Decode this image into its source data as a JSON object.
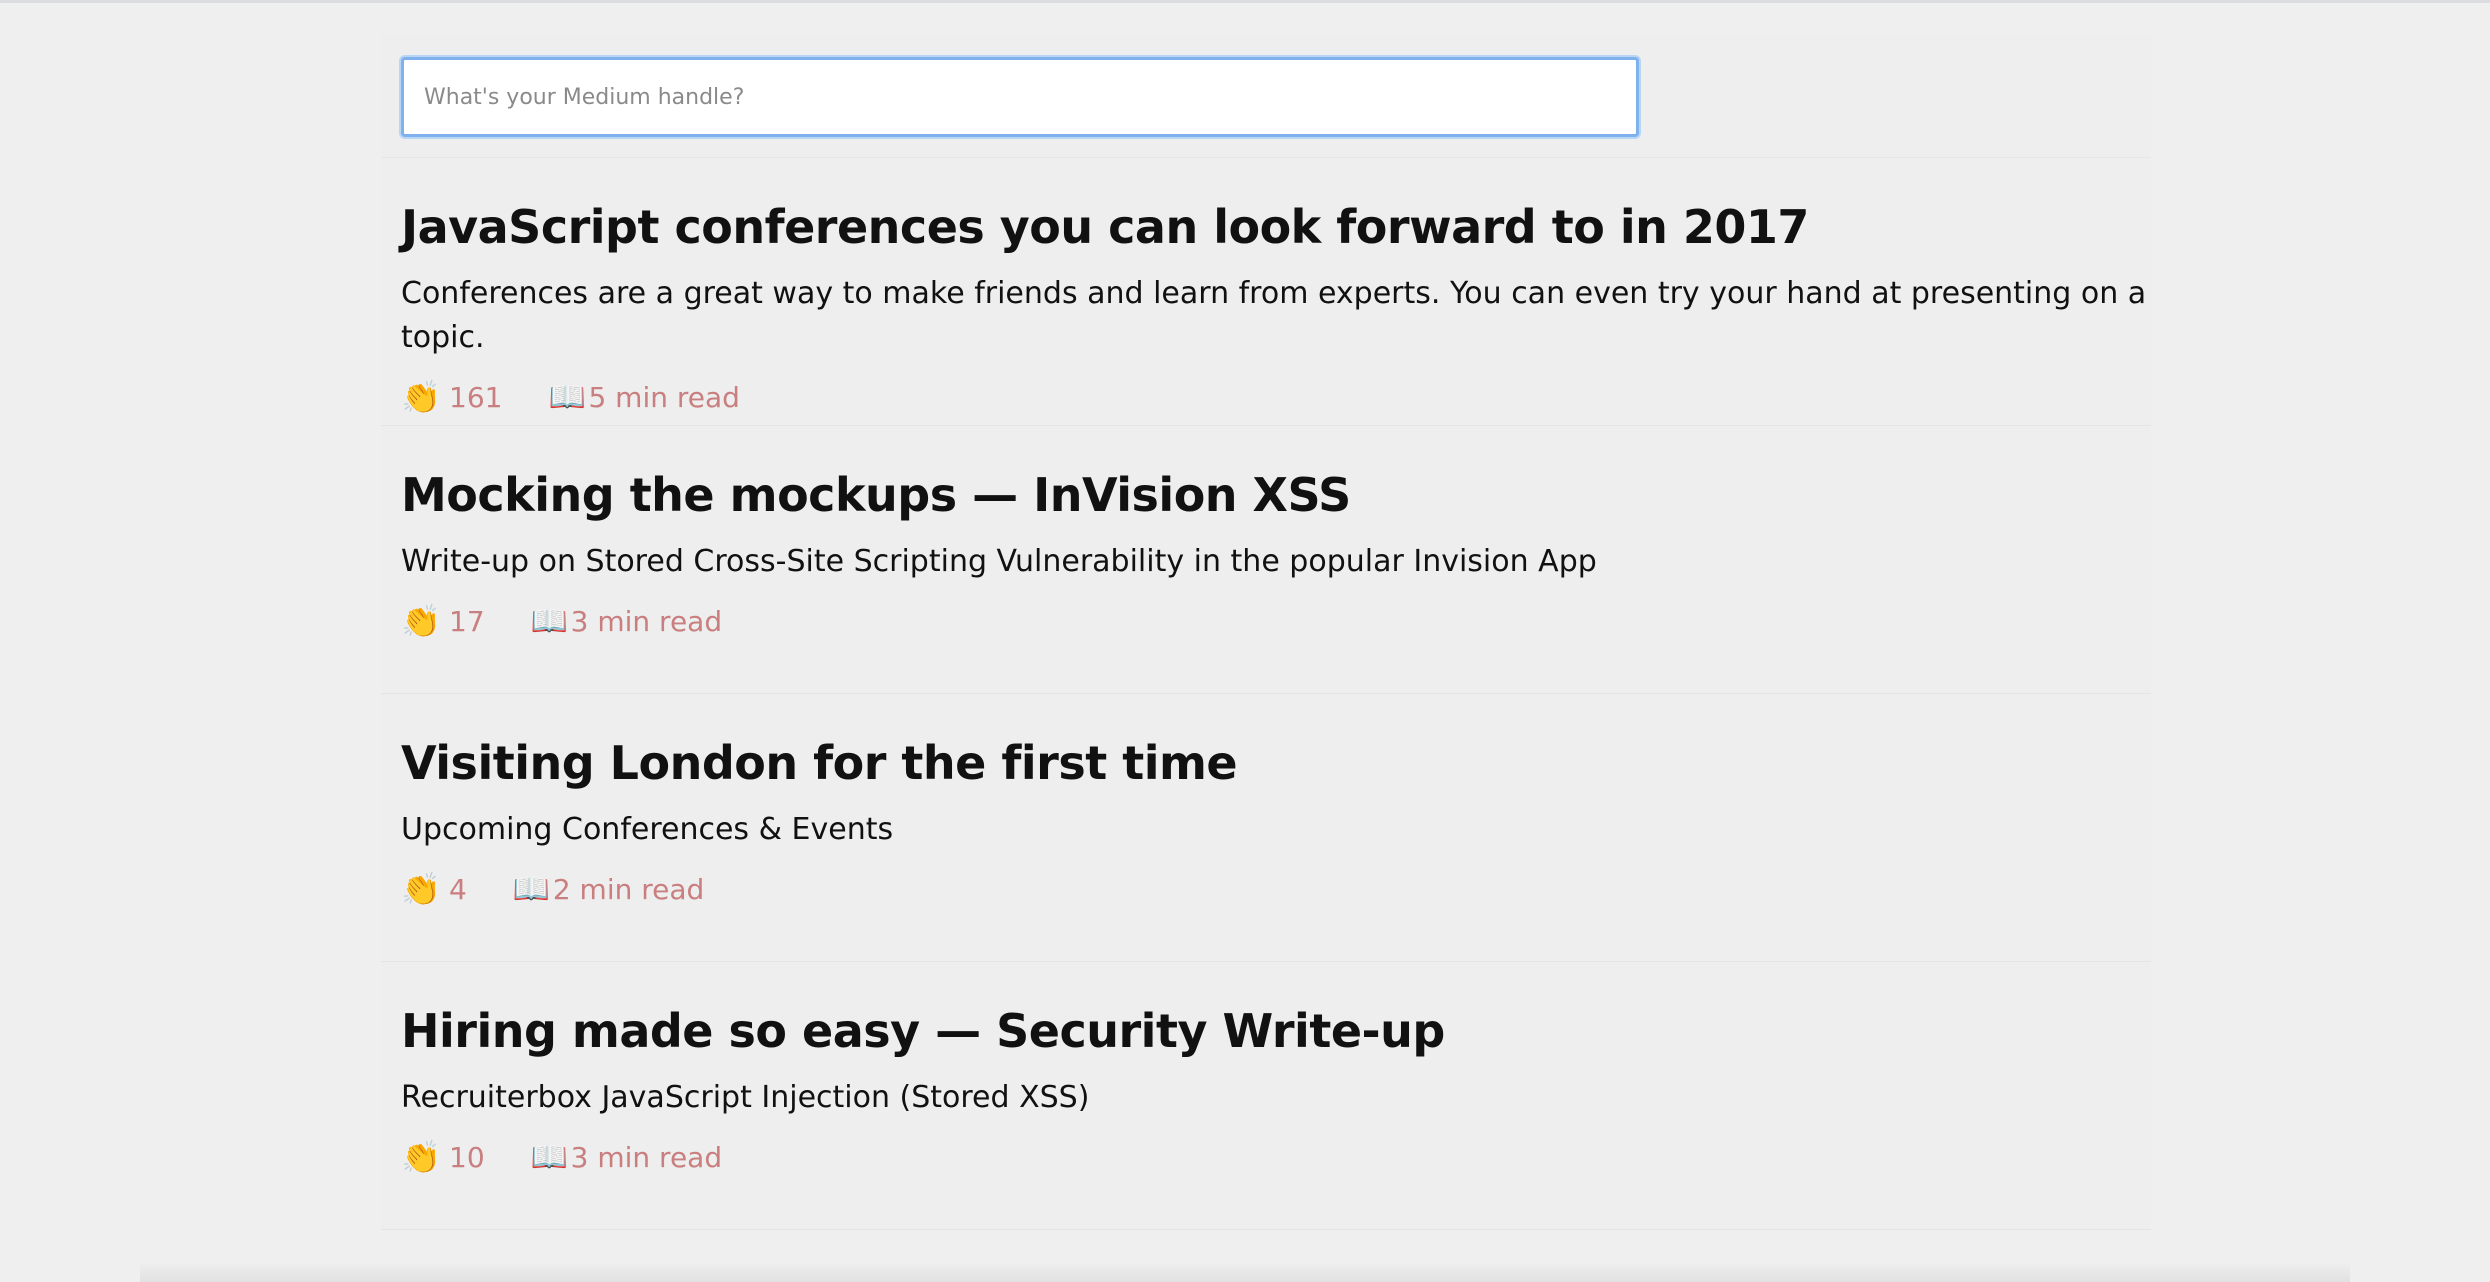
{
  "search": {
    "placeholder": "What's your Medium handle?",
    "value": ""
  },
  "posts": [
    {
      "title": "JavaScript conferences you can look forward to in 2017",
      "subtitle": "Conferences are a great way to make friends and learn from experts. You can even try your hand at presenting on a topic.",
      "claps": "161",
      "read_time": "5 min read"
    },
    {
      "title": "Mocking the mockups — InVision XSS",
      "subtitle": "Write-up on Stored Cross-Site Scripting Vulnerability in the popular Invision App",
      "claps": "17",
      "read_time": "3 min read"
    },
    {
      "title": "Visiting London for the first time",
      "subtitle": "Upcoming Conferences & Events",
      "claps": "4",
      "read_time": "2 min read"
    },
    {
      "title": "Hiring made so easy — Security Write-up",
      "subtitle": "Recruiterbox JavaScript Injection (Stored XSS)",
      "claps": "10",
      "read_time": "3 min read"
    }
  ],
  "icons": {
    "clap": "clap-icon",
    "book": "open-book-icon"
  },
  "colors": {
    "meta_text": "#c97f7f",
    "input_focus_border": "#7fb2ec",
    "background": "#efefef"
  }
}
